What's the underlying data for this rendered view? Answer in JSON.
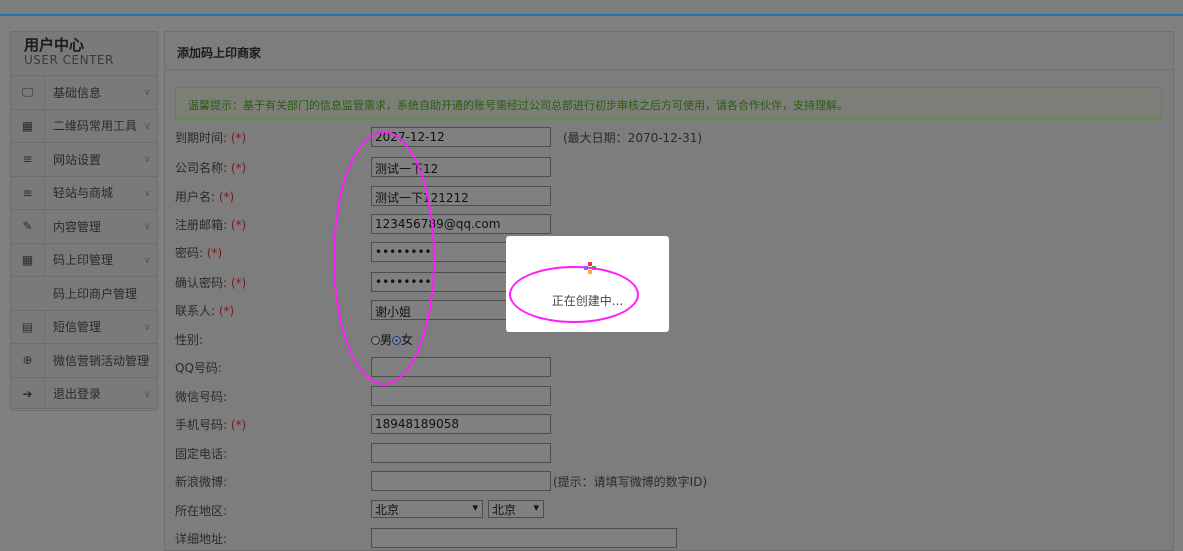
{
  "sidebar": {
    "title": "用户中心",
    "subtitle": "USER CENTER",
    "items": [
      {
        "icon": "monitor-icon",
        "glyph": "🖵",
        "label": "基础信息",
        "chev": "∨"
      },
      {
        "icon": "qrcode-icon",
        "glyph": "▦",
        "label": "二维码常用工具",
        "chev": "∨"
      },
      {
        "icon": "menu-icon",
        "glyph": "≡",
        "label": "网站设置",
        "chev": "∨"
      },
      {
        "icon": "menu-icon",
        "glyph": "≡",
        "label": "轻站与商城",
        "chev": "∨"
      },
      {
        "icon": "edit-icon",
        "glyph": "✎",
        "label": "内容管理",
        "chev": "∨"
      },
      {
        "icon": "qrcode-icon",
        "glyph": "▦",
        "label": "码上印管理",
        "chev": "∨"
      },
      {
        "icon": "",
        "glyph": "",
        "label": "码上印商户管理",
        "chev": ""
      },
      {
        "icon": "database-icon",
        "glyph": "▤",
        "label": "短信管理",
        "chev": "∨"
      },
      {
        "icon": "lifebuoy-icon",
        "glyph": "⊕",
        "label": "微信营销活动管理",
        "chev": "∨"
      },
      {
        "icon": "logout-icon",
        "glyph": "➜",
        "label": "退出登录",
        "chev": "∨"
      }
    ]
  },
  "main": {
    "title": "添加码上印商家",
    "notice": "温馨提示：基于有关部门的信息监管需求，系统自助开通的账号需经过公司总部进行初步审核之后方可使用，请各合作伙伴，支持理解。"
  },
  "form": {
    "required_mark": "(*)",
    "expire": {
      "label": "到期时间:",
      "value": "2027-12-12",
      "hint": "(最大日期：2070-12-31)"
    },
    "company": {
      "label": "公司名称:",
      "value": "测试一下12"
    },
    "username": {
      "label": "用户名:",
      "value": "测试一下121212"
    },
    "email": {
      "label": "注册邮箱:",
      "value": "123456789@qq.com"
    },
    "password": {
      "label": "密码:",
      "value": "••••••••"
    },
    "confirm": {
      "label": "确认密码:",
      "value": "••••••••"
    },
    "contact": {
      "label": "联系人:",
      "value": "谢小姐"
    },
    "gender": {
      "label": "性别:",
      "male": "男",
      "female": "女",
      "selected": "female"
    },
    "qq": {
      "label": "QQ号码:",
      "value": ""
    },
    "wechat": {
      "label": "微信号码:",
      "value": ""
    },
    "mobile": {
      "label": "手机号码:",
      "value": "18948189058"
    },
    "phone": {
      "label": "固定电话:",
      "value": ""
    },
    "weibo": {
      "label": "新浪微博:",
      "value": "",
      "hint": "(提示：请填写微博的数字ID)"
    },
    "region": {
      "label": "所在地区:",
      "province": "北京",
      "city": "北京"
    },
    "address": {
      "label": "详细地址:",
      "value": ""
    }
  },
  "popup": {
    "message": "正在创建中..."
  },
  "colors": {
    "annotation": "#ff1cff",
    "spinner": [
      "#e23b3b",
      "#3b8ee2",
      "#3bb14a",
      "#f0b429"
    ]
  }
}
